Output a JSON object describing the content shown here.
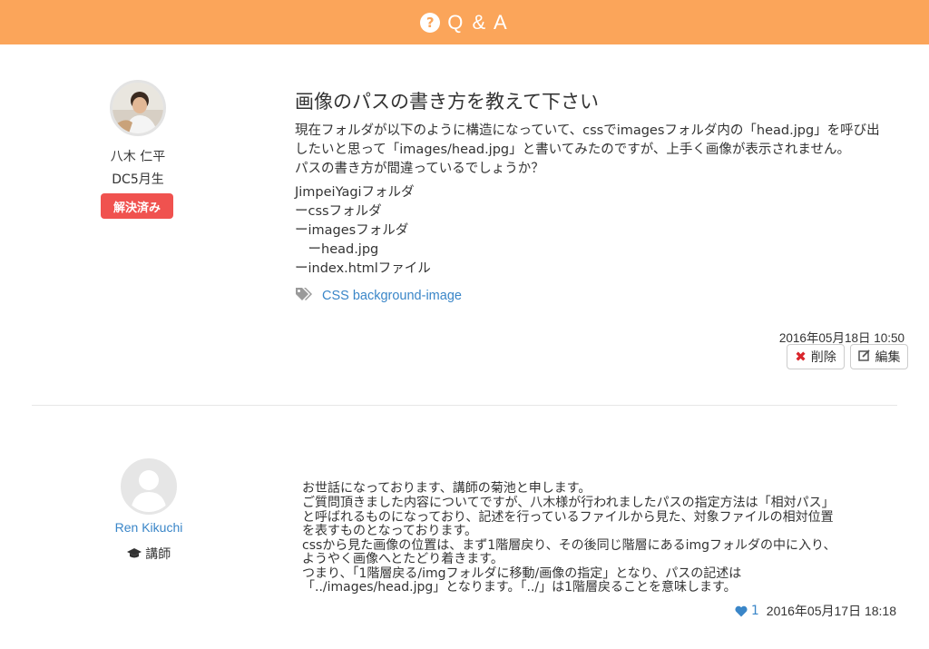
{
  "header": {
    "title": "Q & A"
  },
  "question": {
    "author_name": "八木 仁平",
    "author_course": "DC5月生",
    "status_badge": "解決済み",
    "title": "画像のパスの書き方を教えて下さい",
    "body": [
      "現在フォルダが以下のように構造になっていて、cssでimagesフォルダ内の「head.jpg」を呼び出",
      "したいと思って「images/head.jpg」と書いてみたのですが、上手く画像が表示されません。",
      "パスの書き方が間違っているでしょうか？"
    ],
    "structure_lines": [
      "JimpeiYagiフォルダ",
      "ーcssフォルダ",
      "ーimagesフォルダ",
      "　ーhead.jpg",
      "ーindex.htmlファイル"
    ],
    "tag": "CSS background-image",
    "tag_icon": "tags-icon",
    "date": "2016年05月18日 10:50",
    "delete_label": "削除",
    "edit_label": "編集"
  },
  "answer": {
    "author_name": "Ren Kikuchi",
    "author_role": "講師",
    "role_icon": "graduation-cap-icon",
    "greeting": "お世話になっております、講師の菊池と申します。",
    "body_lines": [
      "ご質問頂きました内容についてですが、八木様が行われましたパスの指定方法は「相対パス」",
      "と呼ばれるものになっており、記述を行っているファイルから見た、対象ファイルの相対位置",
      "を表すものとなっております。",
      "cssから見た画像の位置は、まず1階層戻り、その後同じ階層にあるimgフォルダの中に入り、",
      "ようやく画像へとたどり着きます。",
      "つまり、「1階層戻る/imgフォルダに移動/画像の指定」となり、パスの記述は",
      "「../images/head.jpg」となります。「../」は1階層戻ることを意味します。"
    ],
    "likes": "1",
    "date": "2016年05月17日 18:18"
  },
  "colors": {
    "header": "#fba55a",
    "badge": "#f0524f",
    "link": "#3a86c8",
    "delete": "#d9262c"
  }
}
